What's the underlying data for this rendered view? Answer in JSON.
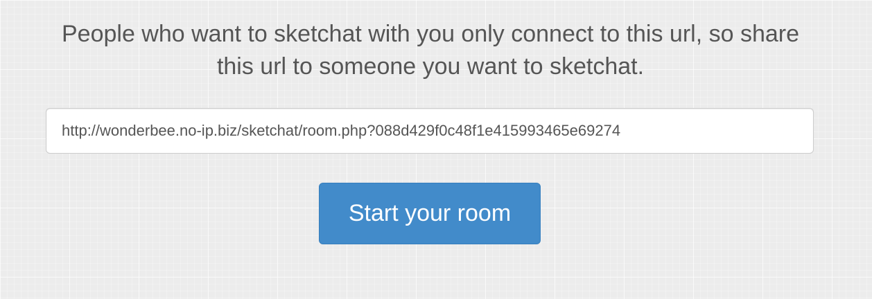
{
  "message": {
    "text": "People who want to sketchat with you only connect to this url, so share this url to someone you want to sketchat."
  },
  "share": {
    "url_value": "http://wonderbee.no-ip.biz/sketchat/room.php?088d429f0c48f1e415993465e69274"
  },
  "actions": {
    "start_label": "Start your room"
  },
  "colors": {
    "primary": "#428bca",
    "text": "#555555"
  }
}
